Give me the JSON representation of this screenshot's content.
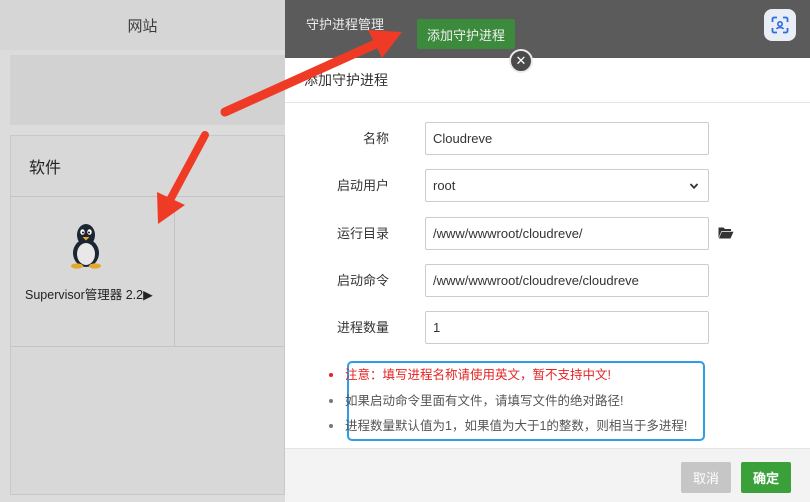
{
  "background": {
    "nav_tab_label": "网站",
    "panel_title": "软件",
    "app_label": "Supervisor管理器 2.2▶"
  },
  "side_panel": {
    "title": "守护进程管理",
    "add_button_label": "添加守护进程"
  },
  "dialog": {
    "title": "添加守护进程",
    "fields": {
      "name": {
        "label": "名称",
        "value": "Cloudreve"
      },
      "user": {
        "label": "启动用户",
        "value": "root"
      },
      "directory": {
        "label": "运行目录",
        "value": "/www/wwwroot/cloudreve/"
      },
      "command": {
        "label": "启动命令",
        "value": "/www/wwwroot/cloudreve/cloudreve"
      },
      "process_count": {
        "label": "进程数量",
        "value": "1"
      }
    },
    "notes": [
      "注意：填写进程名称请使用英文，暂不支持中文!",
      "如果启动命令里面有文件，请填写文件的绝对路径!",
      "进程数量默认值为1，如果值为大于1的整数，则相当于多进程!"
    ],
    "cancel_label": "取消",
    "confirm_label": "确定"
  },
  "colors": {
    "add_button": "#3c8a3c",
    "confirm_button": "#3aa13a",
    "cancel_button": "#c6c6c6",
    "warning_text": "#e52323",
    "annotation_arrow": "#ef3b26",
    "highlight_box": "#2d9de4"
  },
  "icons": {
    "folder": "folder-open-icon",
    "scan": "scan-icon",
    "close": "close-icon",
    "app": "linux-penguin-icon",
    "select_caret": "chevron-down-icon"
  }
}
